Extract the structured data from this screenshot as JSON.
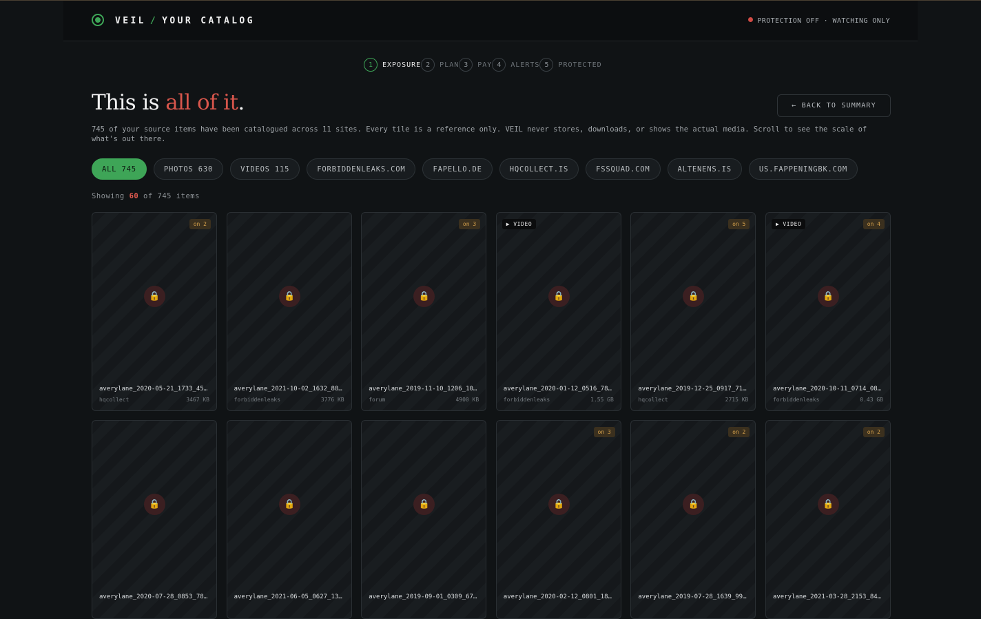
{
  "header": {
    "brand": "VEIL",
    "separator": "/",
    "section": "YOUR CATALOG",
    "status": "PROTECTION OFF · WATCHING ONLY",
    "status_color": "#d14b45"
  },
  "steps": [
    {
      "num": "1",
      "label": "EXPOSURE",
      "active": true
    },
    {
      "num": "2",
      "label": "PLAN",
      "active": false
    },
    {
      "num": "3",
      "label": "PAY",
      "active": false
    },
    {
      "num": "4",
      "label": "ALERTS",
      "active": false
    },
    {
      "num": "5",
      "label": "PROTECTED",
      "active": false
    }
  ],
  "hero": {
    "title_prefix": "This is ",
    "title_highlight": "all of it",
    "title_suffix": ".",
    "back_button": "← BACK TO SUMMARY",
    "description": "745 of your source items have been catalogued across 11 sites. Every tile is a reference only. VEIL never stores, downloads, or shows the actual media. Scroll to see the scale of what's out there."
  },
  "filters": [
    {
      "label": "ALL 745",
      "active": true
    },
    {
      "label": "PHOTOS 630",
      "active": false
    },
    {
      "label": "VIDEOS 115",
      "active": false
    },
    {
      "label": "FORBIDDENLEAKS.COM",
      "active": false
    },
    {
      "label": "FAPELLO.DE",
      "active": false
    },
    {
      "label": "HQCOLLECT.IS",
      "active": false
    },
    {
      "label": "FSSQUAD.COM",
      "active": false
    },
    {
      "label": "ALTENENS.IS",
      "active": false
    },
    {
      "label": "US.FAPPENINGBK.COM",
      "active": false
    }
  ],
  "showing": {
    "prefix": "Showing ",
    "count": "60",
    "suffix": " of 745 items"
  },
  "video_label": "VIDEO",
  "items": [
    {
      "name": "averylane_2020-05-21_1733_45…",
      "source": "hqcollect",
      "size": "3467 KB",
      "on": "on 2",
      "video": false
    },
    {
      "name": "averylane_2021-10-02_1632_88…",
      "source": "forbiddenleaks",
      "size": "3776 KB",
      "on": "",
      "video": false
    },
    {
      "name": "averylane_2019-11-10_1206_10…",
      "source": "forum",
      "size": "4900 KB",
      "on": "on 3",
      "video": false
    },
    {
      "name": "averylane_2020-01-12_0516_78…",
      "source": "forbiddenleaks",
      "size": "1.55 GB",
      "on": "",
      "video": true
    },
    {
      "name": "averylane_2019-12-25_0917_71…",
      "source": "hqcollect",
      "size": "2715 KB",
      "on": "on 5",
      "video": false
    },
    {
      "name": "averylane_2020-10-11_0714_08…",
      "source": "forbiddenleaks",
      "size": "0.43 GB",
      "on": "on 4",
      "video": true
    },
    {
      "name": "averylane_2020-07-28_0853_78…",
      "source": "",
      "size": "",
      "on": "",
      "video": false
    },
    {
      "name": "averylane_2021-06-05_0627_13…",
      "source": "",
      "size": "",
      "on": "",
      "video": false
    },
    {
      "name": "averylane_2019-09-01_0309_67…",
      "source": "",
      "size": "",
      "on": "",
      "video": false
    },
    {
      "name": "averylane_2020-02-12_0801_18…",
      "source": "",
      "size": "",
      "on": "on 3",
      "video": false
    },
    {
      "name": "averylane_2019-07-28_1639_99…",
      "source": "",
      "size": "",
      "on": "on 2",
      "video": false
    },
    {
      "name": "averylane_2021-03-28_2153_84…",
      "source": "",
      "size": "",
      "on": "on 2",
      "video": false
    }
  ],
  "icons": {
    "logo": "logo-ring-icon",
    "lock": "🔒",
    "play": "▶"
  }
}
